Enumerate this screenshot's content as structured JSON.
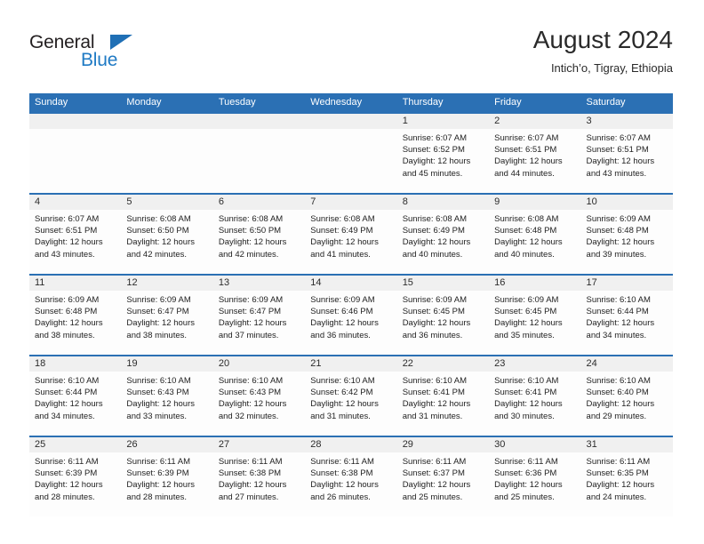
{
  "brand": {
    "name_dark": "General",
    "name_blue": "Blue",
    "accent_color": "#2b70b4",
    "logo_blue": "#1f7ac4"
  },
  "header": {
    "title": "August 2024",
    "subtitle": "Intich’o, Tigray, Ethiopia"
  },
  "table": {
    "weekday_headers": [
      "Sunday",
      "Monday",
      "Tuesday",
      "Wednesday",
      "Thursday",
      "Friday",
      "Saturday"
    ],
    "header_bg": "#2b70b4",
    "daynum_bg": "#f0f0f0",
    "cell_bg": "#fdfdfd"
  },
  "weeks": [
    {
      "days": [
        {
          "num": "",
          "sunrise": "",
          "sunset": "",
          "daylight_1": "",
          "daylight_2": "",
          "empty": true
        },
        {
          "num": "",
          "sunrise": "",
          "sunset": "",
          "daylight_1": "",
          "daylight_2": "",
          "empty": true
        },
        {
          "num": "",
          "sunrise": "",
          "sunset": "",
          "daylight_1": "",
          "daylight_2": "",
          "empty": true
        },
        {
          "num": "",
          "sunrise": "",
          "sunset": "",
          "daylight_1": "",
          "daylight_2": "",
          "empty": true
        },
        {
          "num": "1",
          "sunrise": "Sunrise: 6:07 AM",
          "sunset": "Sunset: 6:52 PM",
          "daylight_1": "Daylight: 12 hours",
          "daylight_2": "and 45 minutes.",
          "empty": false
        },
        {
          "num": "2",
          "sunrise": "Sunrise: 6:07 AM",
          "sunset": "Sunset: 6:51 PM",
          "daylight_1": "Daylight: 12 hours",
          "daylight_2": "and 44 minutes.",
          "empty": false
        },
        {
          "num": "3",
          "sunrise": "Sunrise: 6:07 AM",
          "sunset": "Sunset: 6:51 PM",
          "daylight_1": "Daylight: 12 hours",
          "daylight_2": "and 43 minutes.",
          "empty": false
        }
      ]
    },
    {
      "days": [
        {
          "num": "4",
          "sunrise": "Sunrise: 6:07 AM",
          "sunset": "Sunset: 6:51 PM",
          "daylight_1": "Daylight: 12 hours",
          "daylight_2": "and 43 minutes.",
          "empty": false
        },
        {
          "num": "5",
          "sunrise": "Sunrise: 6:08 AM",
          "sunset": "Sunset: 6:50 PM",
          "daylight_1": "Daylight: 12 hours",
          "daylight_2": "and 42 minutes.",
          "empty": false
        },
        {
          "num": "6",
          "sunrise": "Sunrise: 6:08 AM",
          "sunset": "Sunset: 6:50 PM",
          "daylight_1": "Daylight: 12 hours",
          "daylight_2": "and 42 minutes.",
          "empty": false
        },
        {
          "num": "7",
          "sunrise": "Sunrise: 6:08 AM",
          "sunset": "Sunset: 6:49 PM",
          "daylight_1": "Daylight: 12 hours",
          "daylight_2": "and 41 minutes.",
          "empty": false
        },
        {
          "num": "8",
          "sunrise": "Sunrise: 6:08 AM",
          "sunset": "Sunset: 6:49 PM",
          "daylight_1": "Daylight: 12 hours",
          "daylight_2": "and 40 minutes.",
          "empty": false
        },
        {
          "num": "9",
          "sunrise": "Sunrise: 6:08 AM",
          "sunset": "Sunset: 6:48 PM",
          "daylight_1": "Daylight: 12 hours",
          "daylight_2": "and 40 minutes.",
          "empty": false
        },
        {
          "num": "10",
          "sunrise": "Sunrise: 6:09 AM",
          "sunset": "Sunset: 6:48 PM",
          "daylight_1": "Daylight: 12 hours",
          "daylight_2": "and 39 minutes.",
          "empty": false
        }
      ]
    },
    {
      "days": [
        {
          "num": "11",
          "sunrise": "Sunrise: 6:09 AM",
          "sunset": "Sunset: 6:48 PM",
          "daylight_1": "Daylight: 12 hours",
          "daylight_2": "and 38 minutes.",
          "empty": false
        },
        {
          "num": "12",
          "sunrise": "Sunrise: 6:09 AM",
          "sunset": "Sunset: 6:47 PM",
          "daylight_1": "Daylight: 12 hours",
          "daylight_2": "and 38 minutes.",
          "empty": false
        },
        {
          "num": "13",
          "sunrise": "Sunrise: 6:09 AM",
          "sunset": "Sunset: 6:47 PM",
          "daylight_1": "Daylight: 12 hours",
          "daylight_2": "and 37 minutes.",
          "empty": false
        },
        {
          "num": "14",
          "sunrise": "Sunrise: 6:09 AM",
          "sunset": "Sunset: 6:46 PM",
          "daylight_1": "Daylight: 12 hours",
          "daylight_2": "and 36 minutes.",
          "empty": false
        },
        {
          "num": "15",
          "sunrise": "Sunrise: 6:09 AM",
          "sunset": "Sunset: 6:45 PM",
          "daylight_1": "Daylight: 12 hours",
          "daylight_2": "and 36 minutes.",
          "empty": false
        },
        {
          "num": "16",
          "sunrise": "Sunrise: 6:09 AM",
          "sunset": "Sunset: 6:45 PM",
          "daylight_1": "Daylight: 12 hours",
          "daylight_2": "and 35 minutes.",
          "empty": false
        },
        {
          "num": "17",
          "sunrise": "Sunrise: 6:10 AM",
          "sunset": "Sunset: 6:44 PM",
          "daylight_1": "Daylight: 12 hours",
          "daylight_2": "and 34 minutes.",
          "empty": false
        }
      ]
    },
    {
      "days": [
        {
          "num": "18",
          "sunrise": "Sunrise: 6:10 AM",
          "sunset": "Sunset: 6:44 PM",
          "daylight_1": "Daylight: 12 hours",
          "daylight_2": "and 34 minutes.",
          "empty": false
        },
        {
          "num": "19",
          "sunrise": "Sunrise: 6:10 AM",
          "sunset": "Sunset: 6:43 PM",
          "daylight_1": "Daylight: 12 hours",
          "daylight_2": "and 33 minutes.",
          "empty": false
        },
        {
          "num": "20",
          "sunrise": "Sunrise: 6:10 AM",
          "sunset": "Sunset: 6:43 PM",
          "daylight_1": "Daylight: 12 hours",
          "daylight_2": "and 32 minutes.",
          "empty": false
        },
        {
          "num": "21",
          "sunrise": "Sunrise: 6:10 AM",
          "sunset": "Sunset: 6:42 PM",
          "daylight_1": "Daylight: 12 hours",
          "daylight_2": "and 31 minutes.",
          "empty": false
        },
        {
          "num": "22",
          "sunrise": "Sunrise: 6:10 AM",
          "sunset": "Sunset: 6:41 PM",
          "daylight_1": "Daylight: 12 hours",
          "daylight_2": "and 31 minutes.",
          "empty": false
        },
        {
          "num": "23",
          "sunrise": "Sunrise: 6:10 AM",
          "sunset": "Sunset: 6:41 PM",
          "daylight_1": "Daylight: 12 hours",
          "daylight_2": "and 30 minutes.",
          "empty": false
        },
        {
          "num": "24",
          "sunrise": "Sunrise: 6:10 AM",
          "sunset": "Sunset: 6:40 PM",
          "daylight_1": "Daylight: 12 hours",
          "daylight_2": "and 29 minutes.",
          "empty": false
        }
      ]
    },
    {
      "days": [
        {
          "num": "25",
          "sunrise": "Sunrise: 6:11 AM",
          "sunset": "Sunset: 6:39 PM",
          "daylight_1": "Daylight: 12 hours",
          "daylight_2": "and 28 minutes.",
          "empty": false
        },
        {
          "num": "26",
          "sunrise": "Sunrise: 6:11 AM",
          "sunset": "Sunset: 6:39 PM",
          "daylight_1": "Daylight: 12 hours",
          "daylight_2": "and 28 minutes.",
          "empty": false
        },
        {
          "num": "27",
          "sunrise": "Sunrise: 6:11 AM",
          "sunset": "Sunset: 6:38 PM",
          "daylight_1": "Daylight: 12 hours",
          "daylight_2": "and 27 minutes.",
          "empty": false
        },
        {
          "num": "28",
          "sunrise": "Sunrise: 6:11 AM",
          "sunset": "Sunset: 6:38 PM",
          "daylight_1": "Daylight: 12 hours",
          "daylight_2": "and 26 minutes.",
          "empty": false
        },
        {
          "num": "29",
          "sunrise": "Sunrise: 6:11 AM",
          "sunset": "Sunset: 6:37 PM",
          "daylight_1": "Daylight: 12 hours",
          "daylight_2": "and 25 minutes.",
          "empty": false
        },
        {
          "num": "30",
          "sunrise": "Sunrise: 6:11 AM",
          "sunset": "Sunset: 6:36 PM",
          "daylight_1": "Daylight: 12 hours",
          "daylight_2": "and 25 minutes.",
          "empty": false
        },
        {
          "num": "31",
          "sunrise": "Sunrise: 6:11 AM",
          "sunset": "Sunset: 6:35 PM",
          "daylight_1": "Daylight: 12 hours",
          "daylight_2": "and 24 minutes.",
          "empty": false
        }
      ]
    }
  ]
}
